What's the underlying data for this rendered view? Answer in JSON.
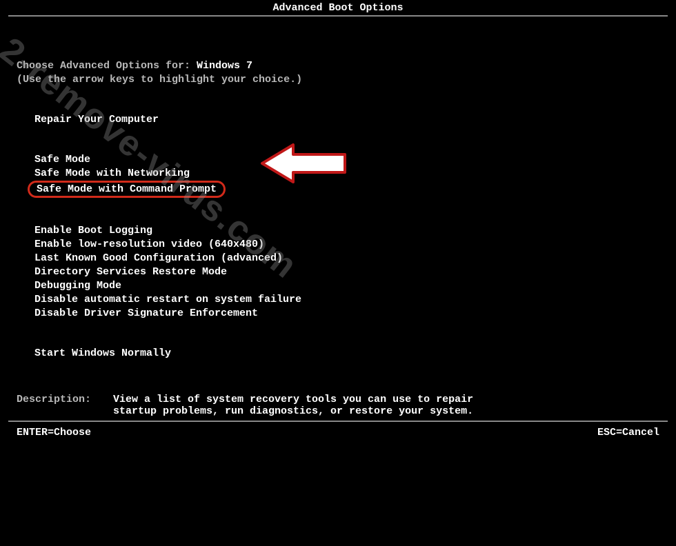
{
  "title": "Advanced Boot Options",
  "header": {
    "choose_prefix": "Choose Advanced Options for: ",
    "os_name": "Windows 7",
    "hint": "(Use the arrow keys to highlight your choice.)"
  },
  "menu": {
    "repair": "Repair Your Computer",
    "safe_mode": "Safe Mode",
    "safe_mode_net": "Safe Mode with Networking",
    "safe_mode_cmd": "Safe Mode with Command Prompt",
    "boot_log": "Enable Boot Logging",
    "low_res": "Enable low-resolution video (640x480)",
    "last_known": "Last Known Good Configuration (advanced)",
    "dsrm": "Directory Services Restore Mode",
    "debug": "Debugging Mode",
    "no_auto_restart": "Disable automatic restart on system failure",
    "no_driver_sig": "Disable Driver Signature Enforcement",
    "normal": "Start Windows Normally"
  },
  "description": {
    "label": "Description:",
    "text1": "View a list of system recovery tools you can use to repair",
    "text2": "startup problems, run diagnostics, or restore your system."
  },
  "footer": {
    "enter": "ENTER=Choose",
    "esc": "ESC=Cancel"
  },
  "watermark": "2-remove-virus.com"
}
